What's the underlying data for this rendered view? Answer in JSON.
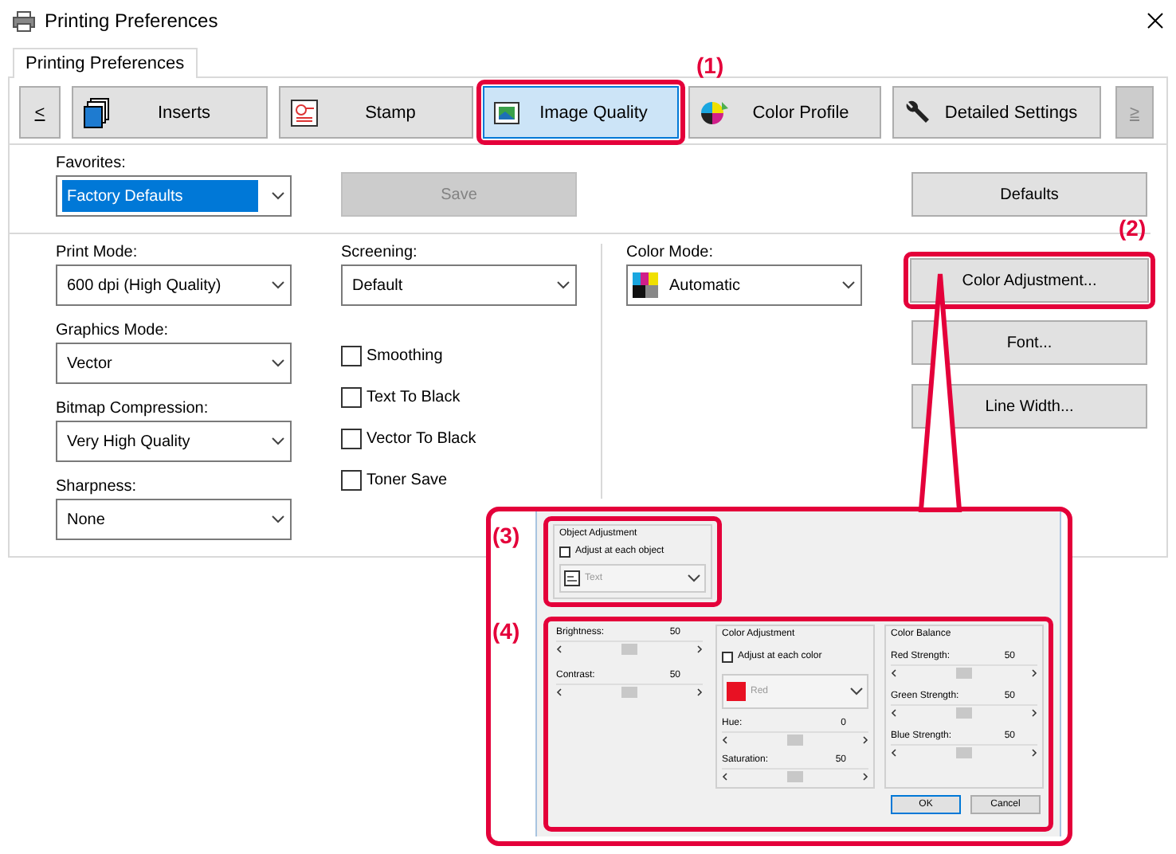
{
  "window": {
    "title": "Printing Preferences"
  },
  "tabs": [
    {
      "label": "Printing Preferences",
      "selected": true
    }
  ],
  "nav": {
    "prev": "<",
    "next": "≥",
    "next_disabled": true
  },
  "categories": [
    {
      "label": "Inserts",
      "kind": "pages",
      "selected": false,
      "highlighted": false
    },
    {
      "label": "Stamp",
      "kind": "stamp",
      "selected": false,
      "highlighted": false
    },
    {
      "label": "Image Quality",
      "kind": "picture",
      "selected": true,
      "highlighted": true
    },
    {
      "label": "Color Profile",
      "kind": "wheel",
      "selected": false,
      "highlighted": false
    },
    {
      "label": "Detailed Settings",
      "kind": "wrench",
      "selected": false,
      "highlighted": false
    }
  ],
  "favorites": {
    "label": "Favorites:",
    "value": "Factory Defaults"
  },
  "save_button": {
    "label": "Save",
    "disabled": true
  },
  "defaults_button": {
    "label": "Defaults"
  },
  "left_fields": [
    {
      "label": "Print Mode:",
      "value": "600 dpi (High Quality)"
    },
    {
      "label": "Graphics Mode:",
      "value": "Vector"
    },
    {
      "label": "Bitmap Compression:",
      "value": "Very High Quality"
    },
    {
      "label": "Sharpness:",
      "value": "None"
    }
  ],
  "screening": {
    "label": "Screening:",
    "value": "Default"
  },
  "checkboxes": [
    {
      "label": "Smoothing",
      "checked": false
    },
    {
      "label": "Text To Black",
      "checked": false
    },
    {
      "label": "Vector To Black",
      "checked": false
    },
    {
      "label": "Toner Save",
      "checked": false
    }
  ],
  "color_mode": {
    "label": "Color Mode:",
    "value": "Automatic"
  },
  "side_buttons": [
    {
      "label": "Color Adjustment...",
      "highlighted": true
    },
    {
      "label": "Font...",
      "highlighted": false
    },
    {
      "label": "Line Width...",
      "highlighted": false
    }
  ],
  "annotations": [
    "(1)",
    "(2)",
    "(3)",
    "(4)"
  ],
  "dialog": {
    "object_group": {
      "title": "Object Adjustment",
      "checkbox": {
        "label": "Adjust at each object",
        "checked": false
      },
      "object": {
        "value": "Text",
        "disabled": true
      }
    },
    "sliders": [
      {
        "label": "Brightness:",
        "reading": "50",
        "level": 0.5
      },
      {
        "label": "Contrast:",
        "reading": "50",
        "level": 0.5
      }
    ],
    "color_group": {
      "title": "Color Adjustment",
      "checkbox": {
        "label": "Adjust at each color",
        "checked": false
      },
      "color": {
        "value": "Red",
        "color": "#e81123",
        "disabled": true
      },
      "sliders": [
        {
          "label": "Hue:",
          "reading": "0",
          "level": 0.5
        },
        {
          "label": "Saturation:",
          "reading": "50",
          "level": 0.5
        }
      ]
    },
    "balance_group": {
      "title": "Color Balance",
      "sliders": [
        {
          "label": "Red Strength:",
          "reading": "50",
          "level": 0.5
        },
        {
          "label": "Green Strength:",
          "reading": "50",
          "level": 0.5
        },
        {
          "label": "Blue Strength:",
          "reading": "50",
          "level": 0.5
        }
      ]
    },
    "buttons": [
      {
        "label": "OK",
        "default": true
      },
      {
        "label": "Cancel",
        "default": false
      }
    ]
  }
}
